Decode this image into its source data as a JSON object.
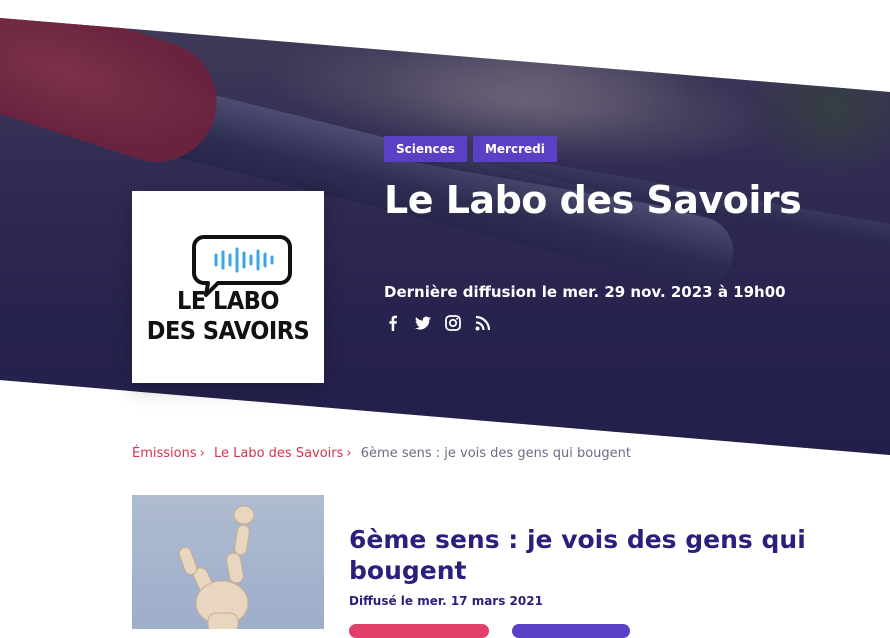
{
  "hero": {
    "tags": [
      "Sciences",
      "Mercredi"
    ],
    "title": "Le Labo des Savoirs",
    "last_aired": "Dernière diffusion le mer. 29 nov. 2023 à 19h00",
    "socials": [
      "facebook-icon",
      "twitter-icon",
      "instagram-icon",
      "rss-icon"
    ]
  },
  "logo": {
    "line1": "LE LABO",
    "line2": "DES SAVOIRS"
  },
  "breadcrumb": {
    "items": [
      "Émissions",
      "Le Labo des Savoirs"
    ],
    "separator": "›",
    "current": "6ème sens : je vois des gens qui bougent"
  },
  "episode": {
    "title": "6ème sens : je vois des gens qui bougent",
    "aired": "Diffusé le mer. 17 mars 2021"
  },
  "colors": {
    "accent_violet": "#5b3fc4",
    "title_navy": "#2a1f7a",
    "link_red": "#d8334a",
    "hero_overlay": "#24224a"
  }
}
